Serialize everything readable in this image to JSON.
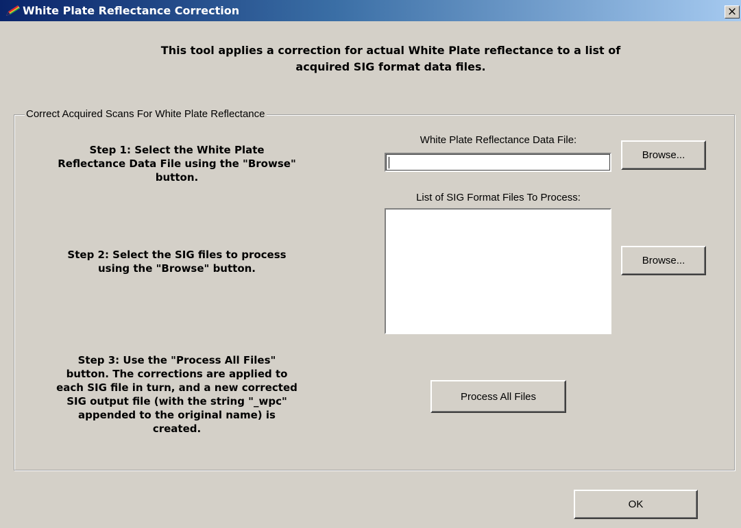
{
  "window": {
    "title": "White Plate Reflectance Correction",
    "close_label": "×"
  },
  "intro_text": "This tool applies a correction for actual White Plate reflectance to a list of acquired SIG format data files.",
  "group": {
    "legend": "Correct Acquired Scans For White Plate Reflectance",
    "step1": "Step 1: Select the White Plate Reflectance Data File using the \"Browse\" button.",
    "step2": "Step 2: Select the SIG files to process using the \"Browse\" button.",
    "step3": "Step 3: Use the \"Process All Files\" button. The corrections are applied to each SIG file in turn, and a new corrected SIG output file (with the string \"_wpc\" appended to the original name) is created.",
    "white_plate_label": "White Plate Reflectance Data File:",
    "white_plate_value": "",
    "sig_list_label": "List of SIG Format Files To Process:",
    "sig_list_items": [],
    "browse_label_1": "Browse...",
    "browse_label_2": "Browse...",
    "process_label": "Process All Files"
  },
  "ok_label": "OK",
  "icons": {
    "app": "pencil-rainbow-icon",
    "close": "close-icon"
  },
  "colors": {
    "titlebar_start": "#0a246a",
    "titlebar_end": "#a6caf0",
    "dialog_bg": "#d4d0c8"
  }
}
